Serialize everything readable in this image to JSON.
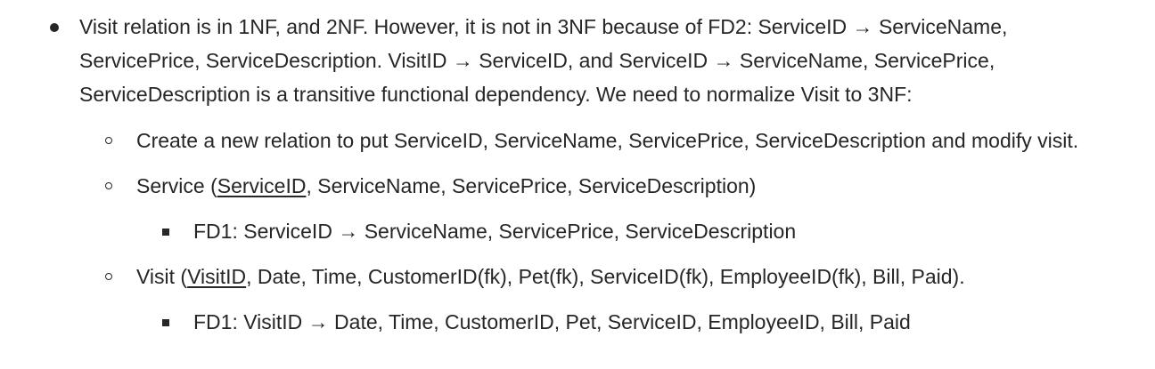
{
  "paragraph": {
    "line1": "Visit relation is in 1NF, and 2NF. However, it is not in 3NF because of FD2: ServiceID  → ServiceName,",
    "line2": "ServicePrice, ServiceDescription. VisitID → ServiceID, and ServiceID  → ServiceName, ServicePrice,",
    "line3": "ServiceDescription is a transitive functional dependency. We need to normalize Visit to 3NF:"
  },
  "sub1": {
    "text": "Create a new relation to put ServiceID, ServiceName, ServicePrice, ServiceDescription and modify visit."
  },
  "sub2": {
    "prefix": "Service (",
    "key": "ServiceID",
    "suffix": ", ServiceName, ServicePrice, ServiceDescription)",
    "fd": "FD1: ServiceID  → ServiceName, ServicePrice, ServiceDescription"
  },
  "sub3": {
    "prefix": "Visit (",
    "key": "VisitID",
    "suffix": ", Date, Time, CustomerID(fk), Pet(fk), ServiceID(fk), EmployeeID(fk), Bill, Paid).",
    "fd": "FD1: VisitID → Date, Time, CustomerID, Pet, ServiceID, EmployeeID, Bill, Paid"
  }
}
